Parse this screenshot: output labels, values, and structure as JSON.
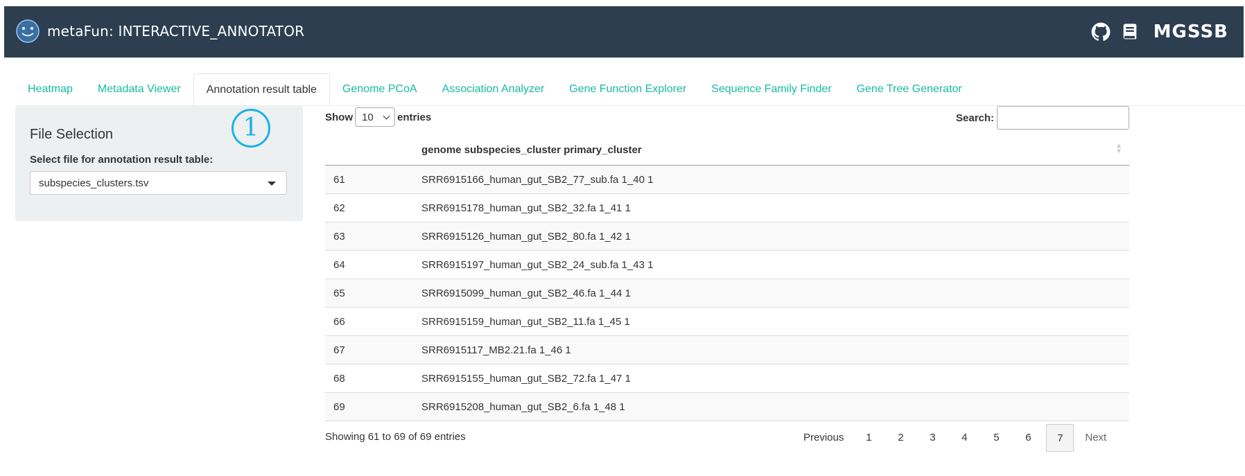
{
  "header": {
    "title": "metaFun: INTERACTIVE_ANNOTATOR",
    "icons": [
      "smiley-logo-icon",
      "github-icon",
      "book-icon"
    ],
    "brand": "MGSSB"
  },
  "tabs": [
    {
      "label": "Heatmap",
      "active": false
    },
    {
      "label": "Metadata Viewer",
      "active": false
    },
    {
      "label": "Annotation result table",
      "active": true
    },
    {
      "label": "Genome PCoA",
      "active": false
    },
    {
      "label": "Association Analyzer",
      "active": false
    },
    {
      "label": "Gene Function Explorer",
      "active": false
    },
    {
      "label": "Sequence Family Finder",
      "active": false
    },
    {
      "label": "Gene Tree Generator",
      "active": false
    }
  ],
  "sidebar": {
    "title": "File Selection",
    "label": "Select file for annotation result table:",
    "selected_file": "subspecies_clusters.tsv",
    "badge": "1"
  },
  "table_controls": {
    "show_label": "Show",
    "length_value": "10",
    "entries_label": "entries",
    "search_label": "Search:",
    "search_value": ""
  },
  "table": {
    "columns": [
      "",
      "genome subspecies_cluster primary_cluster"
    ],
    "rows": [
      {
        "idx": "61",
        "value": "SRR6915166_human_gut_SB2_77_sub.fa 1_40 1"
      },
      {
        "idx": "62",
        "value": "SRR6915178_human_gut_SB2_32.fa 1_41 1"
      },
      {
        "idx": "63",
        "value": "SRR6915126_human_gut_SB2_80.fa 1_42 1"
      },
      {
        "idx": "64",
        "value": "SRR6915197_human_gut_SB2_24_sub.fa 1_43 1"
      },
      {
        "idx": "65",
        "value": "SRR6915099_human_gut_SB2_46.fa 1_44 1"
      },
      {
        "idx": "66",
        "value": "SRR6915159_human_gut_SB2_11.fa 1_45 1"
      },
      {
        "idx": "67",
        "value": "SRR6915117_MB2.21.fa 1_46 1"
      },
      {
        "idx": "68",
        "value": "SRR6915155_human_gut_SB2_72.fa 1_47 1"
      },
      {
        "idx": "69",
        "value": "SRR6915208_human_gut_SB2_6.fa 1_48 1"
      }
    ]
  },
  "footer": {
    "info": "Showing 61 to 69 of 69 entries",
    "previous": "Previous",
    "pages": [
      "1",
      "2",
      "3",
      "4",
      "5",
      "6",
      "7"
    ],
    "current_page": "7",
    "next": "Next"
  },
  "colors": {
    "navbar": "#2c3e50",
    "tab_link": "#18bc9c",
    "sidebar_bg": "#ecf0f1",
    "badge": "#1ab2e8"
  }
}
